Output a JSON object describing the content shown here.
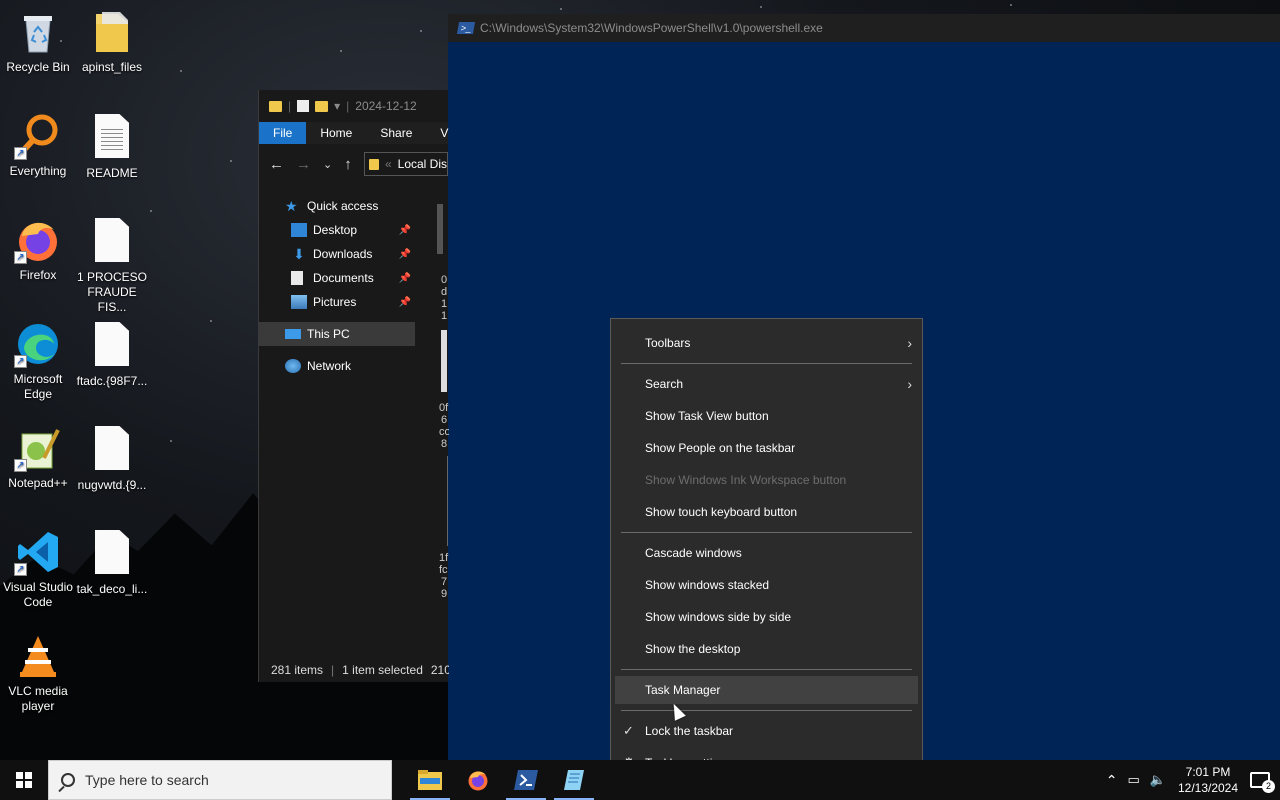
{
  "desktop": {
    "icons": [
      {
        "label": "Recycle Bin",
        "icon": "recycle-bin-icon"
      },
      {
        "label": "apinst_files",
        "icon": "folder-icon"
      },
      {
        "label": "Everything",
        "icon": "everything-search-icon"
      },
      {
        "label": "README",
        "icon": "text-file-icon"
      },
      {
        "label": "Firefox",
        "icon": "firefox-icon"
      },
      {
        "label": "1 PROCESO FRAUDE FIS...",
        "icon": "file-icon"
      },
      {
        "label": "Microsoft Edge",
        "icon": "edge-icon"
      },
      {
        "label": "ftadc.{98F7...",
        "icon": "file-icon"
      },
      {
        "label": "Notepad++",
        "icon": "notepadpp-icon"
      },
      {
        "label": "nugvwtd.{9...",
        "icon": "file-icon"
      },
      {
        "label": "Visual Studio Code",
        "icon": "vscode-icon"
      },
      {
        "label": "tak_deco_li...",
        "icon": "file-icon"
      },
      {
        "label": "VLC media player",
        "icon": "vlc-icon"
      }
    ]
  },
  "powershell": {
    "title": "C:\\Windows\\System32\\WindowsPowerShell\\v1.0\\powershell.exe",
    "bg_color": "#012456"
  },
  "explorer": {
    "title": "2024-12-12",
    "ribbon_tabs": [
      "File",
      "Home",
      "Share",
      "V"
    ],
    "address": "Local Dis",
    "nav": {
      "quick_access": "Quick access",
      "desktop": "Desktop",
      "downloads": "Downloads",
      "documents": "Documents",
      "pictures": "Pictures",
      "this_pc": "This PC",
      "network": "Network"
    },
    "content_fragments": [
      "0",
      "d",
      "1",
      "1",
      "0f",
      "6",
      "co",
      "8",
      "1f",
      "fc",
      "7",
      "9"
    ],
    "status": {
      "items": "281 items",
      "selected": "1 item selected",
      "size": "210"
    }
  },
  "context_menu": {
    "items": {
      "toolbars": "Toolbars",
      "search": "Search",
      "task_view": "Show Task View button",
      "people": "Show People on the taskbar",
      "ink": "Show Windows Ink Workspace button",
      "touch_keyboard": "Show touch keyboard button",
      "cascade": "Cascade windows",
      "stacked": "Show windows stacked",
      "side_by_side": "Show windows side by side",
      "show_desktop": "Show the desktop",
      "task_manager": "Task Manager",
      "lock_taskbar": "Lock the taskbar",
      "taskbar_settings": "Taskbar settings"
    }
  },
  "taskbar": {
    "search_placeholder": "Type here to search",
    "apps": [
      "file-explorer-icon",
      "firefox-icon",
      "powershell-icon",
      "notepad-icon"
    ],
    "clock_time": "7:01 PM",
    "clock_date": "12/13/2024",
    "notification_count": "2"
  },
  "colors": {
    "accent": "#1a73c8",
    "menu_bg": "#2b2b2b",
    "taskbar_bg": "#101010"
  }
}
